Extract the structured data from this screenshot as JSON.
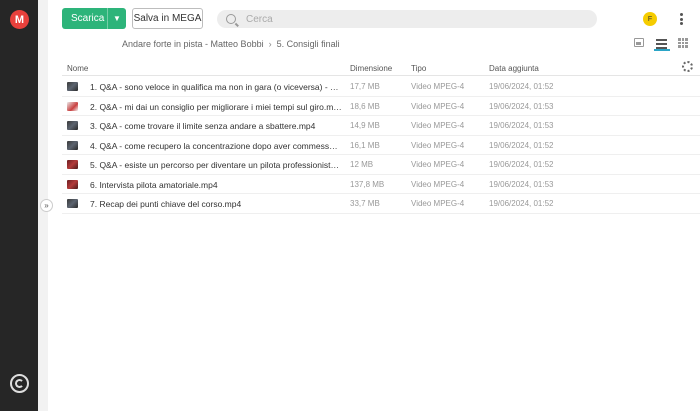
{
  "sidebar": {
    "logo_letter": "M",
    "logo_color": "#e8413c",
    "bottom_icon": "sync-icon"
  },
  "toolbar": {
    "download_label": "Scarica",
    "download_dropdown_icon": "chevron-down-icon",
    "save_label": "Salva in MEGA",
    "accent": "#2db47a"
  },
  "search": {
    "placeholder": "Cerca",
    "icon": "search-icon"
  },
  "account": {
    "avatar_letter": "F",
    "avatar_color": "#f5cc00",
    "menu_icon": "more-vertical-icon"
  },
  "breadcrumb": {
    "items": [
      "Andare forte in pista - Matteo Bobbi",
      "5. Consigli finali"
    ]
  },
  "view_modes": {
    "thumbnail_icon": "image-icon",
    "list_icon": "list-icon",
    "grid_icon": "grid-icon",
    "active": "list"
  },
  "table": {
    "columns": {
      "name": "Nome",
      "size": "Dimensione",
      "type": "Tipo",
      "date": "Data aggiunta"
    },
    "settings_icon": "gear-icon",
    "rows": [
      {
        "name": "1. Q&A - sono veloce in qualifica ma non in gara (o viceversa) - cos...",
        "size": "17,7 MB",
        "type": "Video MPEG-4",
        "date": "19/06/2024, 01:52"
      },
      {
        "name": "2. Q&A - mi dai un consiglio per migliorare i miei tempi sul giro.mp4",
        "size": "18,6 MB",
        "type": "Video MPEG-4",
        "date": "19/06/2024, 01:53"
      },
      {
        "name": "3. Q&A - come trovare il limite senza andare a sbattere.mp4",
        "size": "14,9 MB",
        "type": "Video MPEG-4",
        "date": "19/06/2024, 01:53"
      },
      {
        "name": "4. Q&A - come recupero la concentrazione dopo aver commesso ...",
        "size": "16,1 MB",
        "type": "Video MPEG-4",
        "date": "19/06/2024, 01:52"
      },
      {
        "name": "5. Q&A - esiste un percorso per diventare un pilota professionista....",
        "size": "12 MB",
        "type": "Video MPEG-4",
        "date": "19/06/2024, 01:52"
      },
      {
        "name": "6. Intervista pilota amatoriale.mp4",
        "size": "137,8 MB",
        "type": "Video MPEG-4",
        "date": "19/06/2024, 01:53"
      },
      {
        "name": "7. Recap dei punti chiave del corso.mp4",
        "size": "33,7 MB",
        "type": "Video MPEG-4",
        "date": "19/06/2024, 01:52"
      }
    ]
  }
}
